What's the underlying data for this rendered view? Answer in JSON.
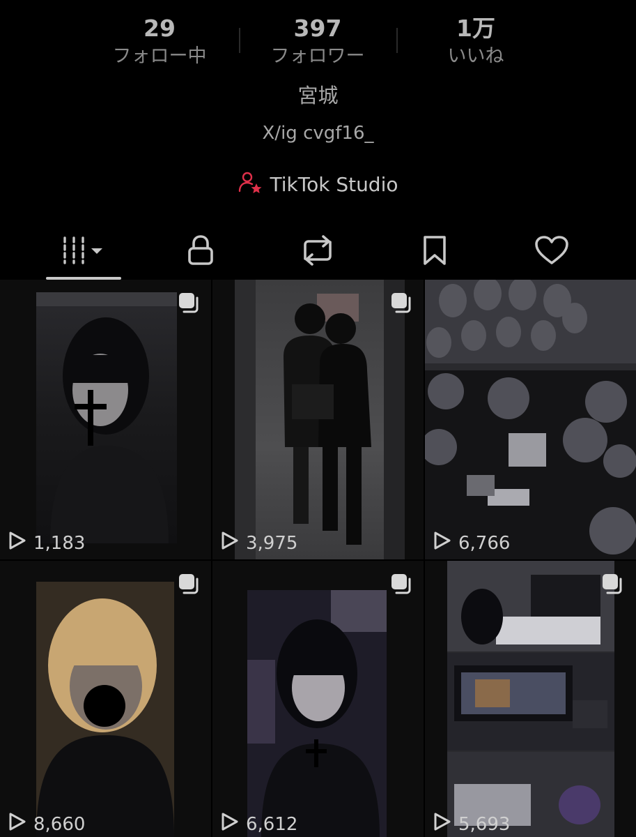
{
  "stats": [
    {
      "value": "29",
      "label": "フォロー中"
    },
    {
      "value": "397",
      "label": "フォロワー"
    },
    {
      "value": "1万",
      "label": "いいね"
    }
  ],
  "profile": {
    "location": "宮城",
    "bio": "X/ig cvgf16_",
    "studio_label": "TikTok Studio"
  },
  "tabs": [
    {
      "icon": "grid-icon",
      "active": true
    },
    {
      "icon": "lock-icon",
      "active": false
    },
    {
      "icon": "repost-icon",
      "active": false
    },
    {
      "icon": "bookmark-icon",
      "active": false
    },
    {
      "icon": "heart-icon",
      "active": false
    }
  ],
  "videos": [
    {
      "views": "1,183",
      "description": "dark-haired person with cross"
    },
    {
      "views": "3,975",
      "description": "two people mirror selfie"
    },
    {
      "views": "6,766",
      "description": "birthday balloons room"
    },
    {
      "views": "8,660",
      "description": "blonde-haired person"
    },
    {
      "views": "6,612",
      "description": "dark-haired person with cross necklace"
    },
    {
      "views": "5,693",
      "description": "gaming setup room"
    }
  ],
  "colors": {
    "background": "#000000",
    "studio_icon": "#e0304a",
    "text": "#a8a8a8"
  }
}
